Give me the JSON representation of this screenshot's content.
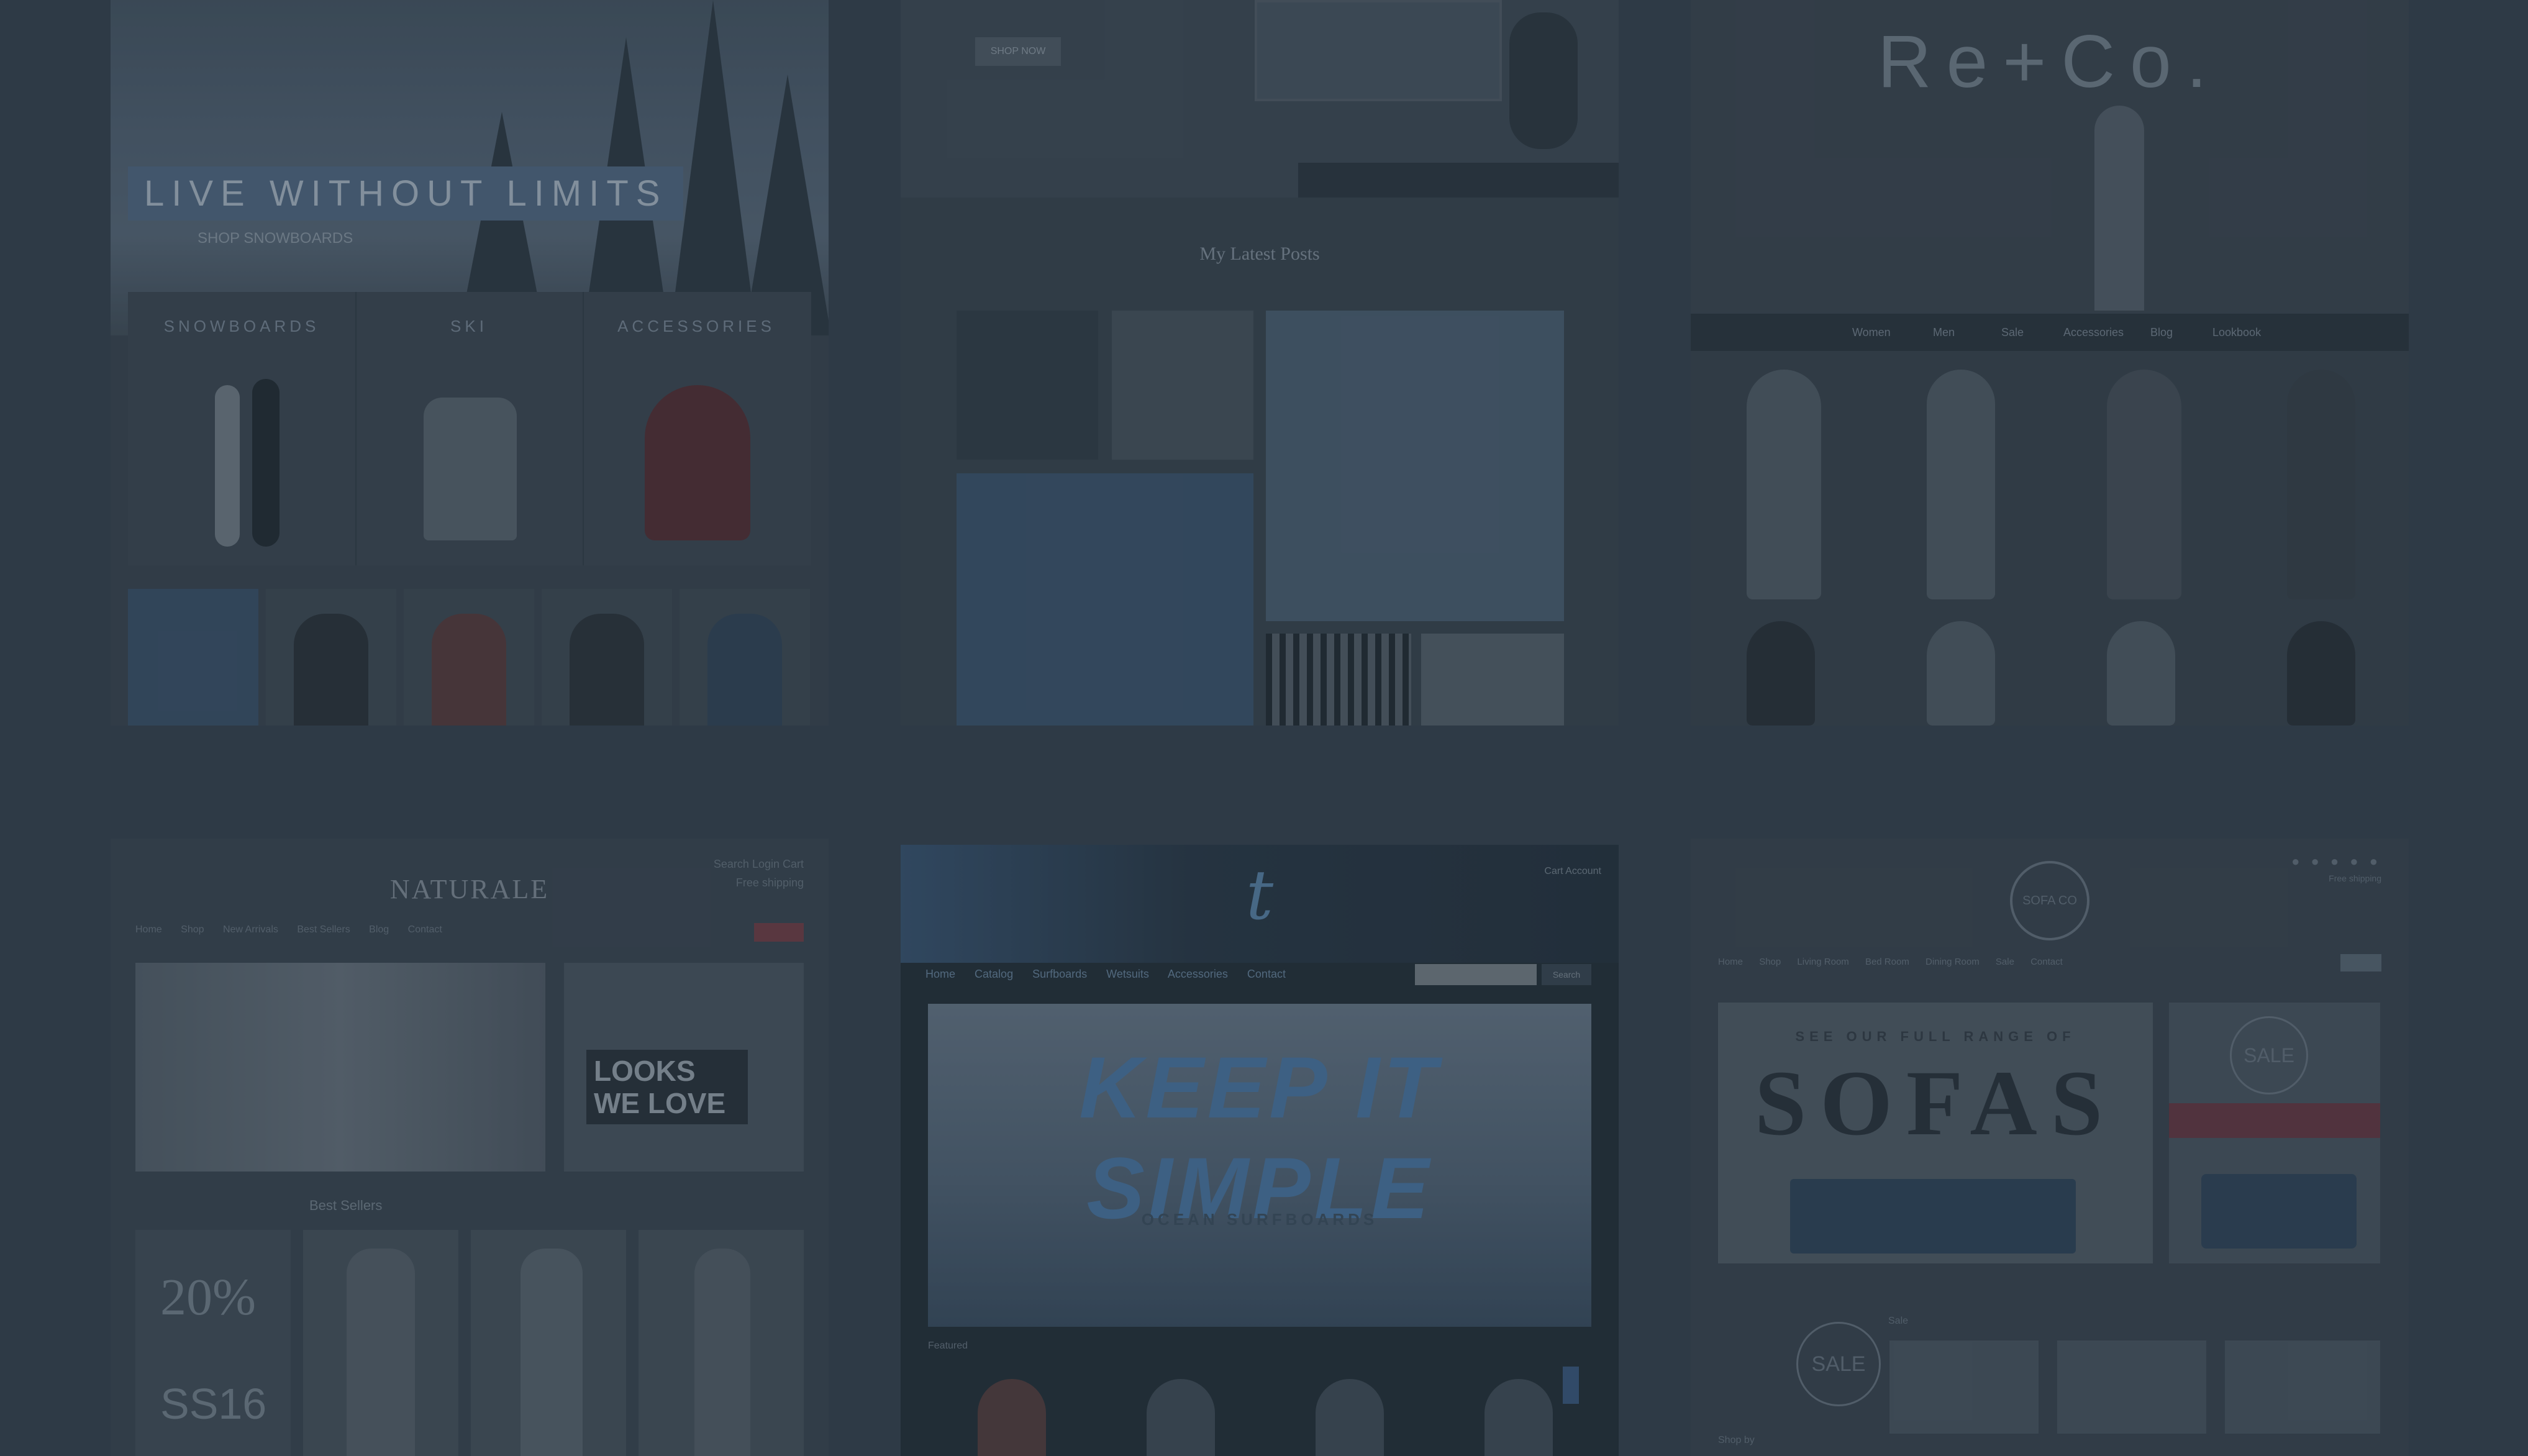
{
  "card1": {
    "hero_text": "LIVE WITHOUT LIMITS",
    "hero_sub": "SHOP SNOWBOARDS",
    "categories": [
      "SNOWBOARDS",
      "SKI",
      "ACCESSORIES"
    ]
  },
  "card2": {
    "button": "SHOP NOW",
    "gallery_title": "My Latest Posts"
  },
  "card3": {
    "logo": "Re+Co.",
    "nav": [
      "Women",
      "Men",
      "Sale",
      "Accessories",
      "Blog",
      "Lookbook"
    ]
  },
  "card4": {
    "brand": "NATURALE",
    "top_right": [
      "Search  Login  Cart",
      "Free shipping"
    ],
    "menu": [
      "Home",
      "Shop",
      "New Arrivals",
      "Best Sellers",
      "Blog",
      "Contact"
    ],
    "looks_line1": "LOOKS",
    "looks_line2": "WE LOVE",
    "best_sellers": "Best Sellers",
    "promo_pct": "20%",
    "promo_season": "SS16"
  },
  "card5": {
    "logo": "t",
    "top_right": "Cart  Account",
    "nav": [
      "Home",
      "Catalog",
      "Surfboards",
      "Wetsuits",
      "Accessories",
      "Contact"
    ],
    "search_button": "Search",
    "headline": "KEEP IT SIMPLE",
    "subhead": "OCEAN SURFBOARDS",
    "section_label": "Featured"
  },
  "card6": {
    "logo": "SOFA CO",
    "dots": "● ● ● ● ●",
    "dots_caption": "Free shipping",
    "menu": [
      "Home",
      "Shop",
      "Living Room",
      "Bed Room",
      "Dining Room",
      "Sale",
      "Contact"
    ],
    "tagline": "SEE OUR FULL RANGE OF",
    "headline": "SOFAS",
    "badge": "SALE",
    "badge2": "SALE",
    "sale_label": "Sale",
    "shop_label": "Shop by"
  }
}
